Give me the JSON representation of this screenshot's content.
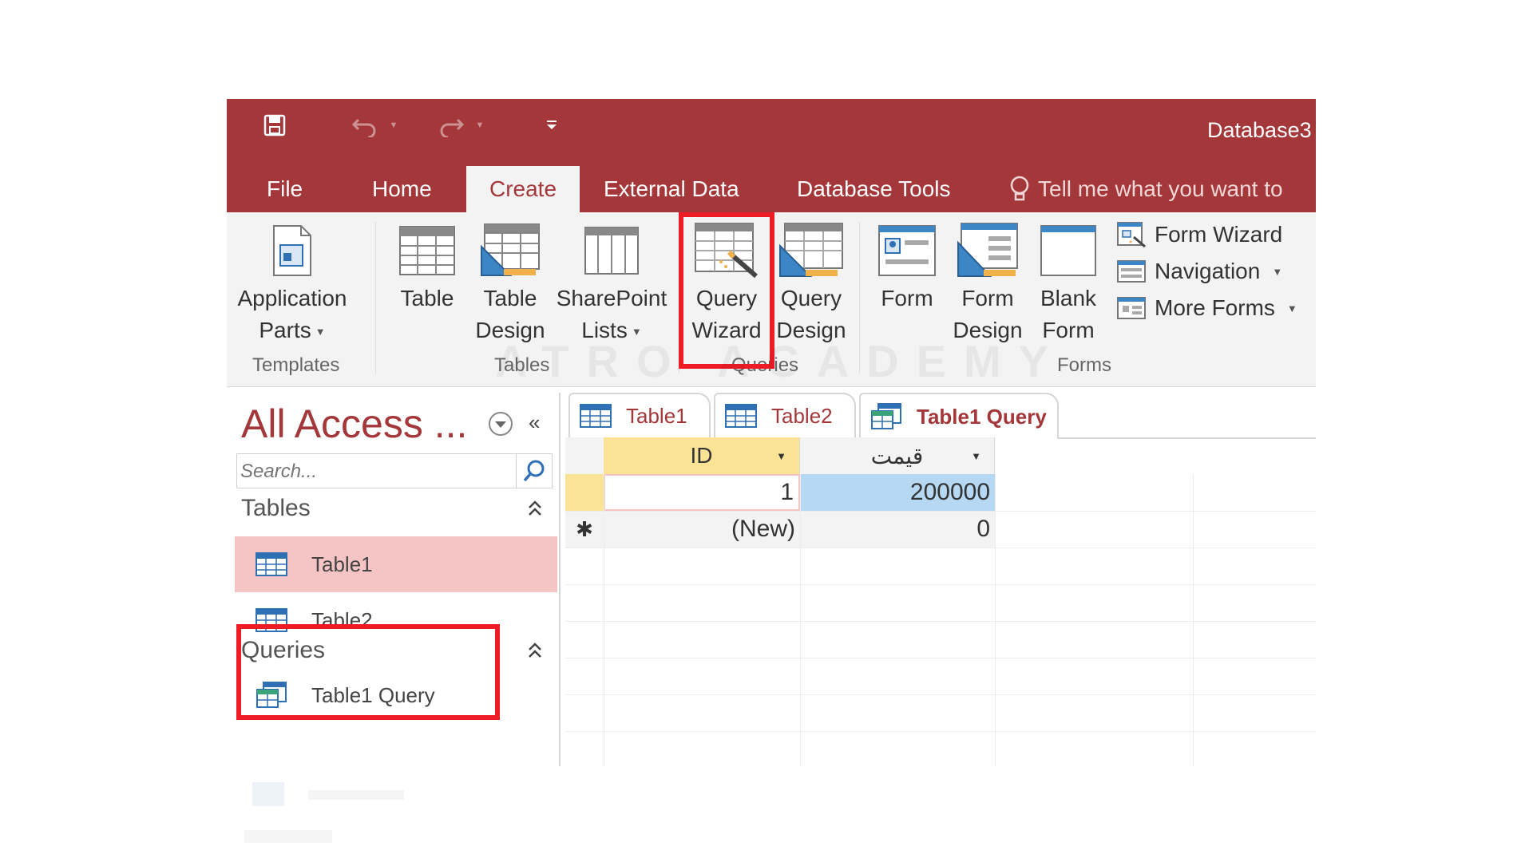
{
  "titlebar": {
    "title": "Database3",
    "qat": {
      "save": "save-icon",
      "undo": "undo-icon",
      "redo": "redo-icon",
      "customize": "customize-icon"
    },
    "color": "#a4373a"
  },
  "tabs": {
    "file": "File",
    "home": "Home",
    "create": "Create",
    "external": "External Data",
    "dbtools": "Database Tools",
    "tell_me": "Tell me what you want to",
    "active": "Create"
  },
  "ribbon": {
    "application_parts": {
      "line1": "Application",
      "line2": "Parts"
    },
    "table": {
      "line1": "Table",
      "line2": ""
    },
    "table_design": {
      "line1": "Table",
      "line2": "Design"
    },
    "sharepoint_lists": {
      "line1": "SharePoint",
      "line2": "Lists"
    },
    "query_wizard": {
      "line1": "Query",
      "line2": "Wizard"
    },
    "query_design": {
      "line1": "Query",
      "line2": "Design"
    },
    "form": {
      "line1": "Form",
      "line2": ""
    },
    "form_design": {
      "line1": "Form",
      "line2": "Design"
    },
    "blank_form": {
      "line1": "Blank",
      "line2": "Form"
    },
    "form_wizard": "Form Wizard",
    "navigation": "Navigation",
    "more_forms": "More Forms",
    "groups": {
      "templates": "Templates",
      "tables": "Tables",
      "queries": "Queries",
      "forms": "Forms"
    },
    "highlight_color": "#ee1c25"
  },
  "nav": {
    "title": "All Access ...",
    "search_placeholder": "Search...",
    "tables_header": "Tables",
    "tables": [
      "Table1",
      "Table2"
    ],
    "queries_header": "Queries",
    "queries": [
      "Table1 Query"
    ],
    "selected_color": "#f5c5c6"
  },
  "doc": {
    "tabs": [
      "Table1",
      "Table2",
      "Table1 Query"
    ],
    "active_tab": "Table1 Query",
    "columns": [
      "ID",
      "قیمت"
    ],
    "rows": [
      [
        "1",
        "200000"
      ]
    ],
    "new_row": [
      "(New)",
      "0"
    ],
    "new_row_marker": "✱"
  },
  "watermark": "ATRO ACADEMY"
}
